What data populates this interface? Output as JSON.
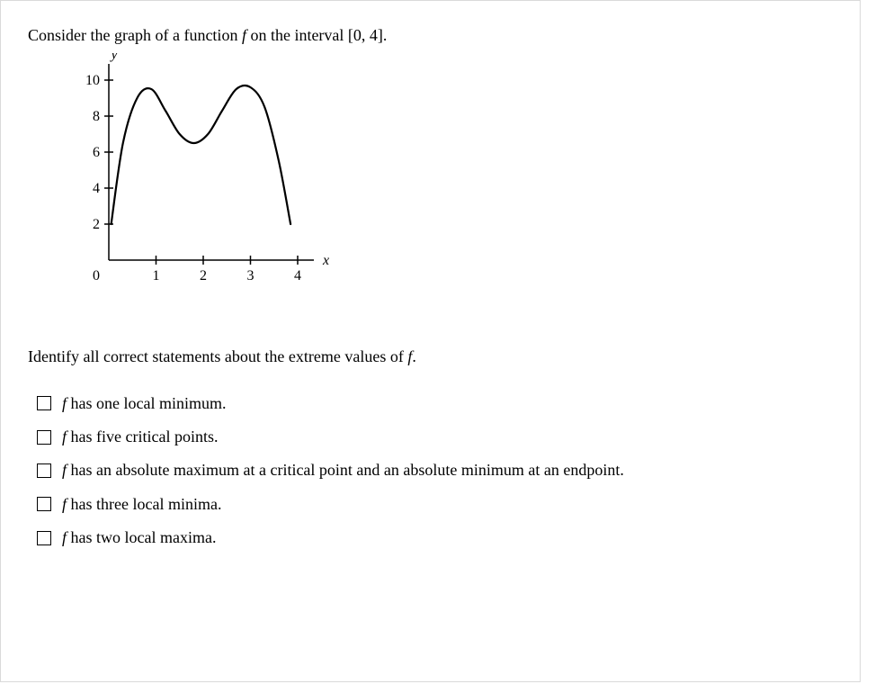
{
  "intro": {
    "prefix": "Consider the graph of a function ",
    "func": "f",
    "middle": " on the interval ",
    "interval": "[0, 4]",
    "suffix": "."
  },
  "chart_data": {
    "type": "line",
    "title": "",
    "xlabel": "x",
    "ylabel": "y",
    "xlim": [
      0,
      4
    ],
    "ylim": [
      0,
      10
    ],
    "x_ticks": [
      0,
      1,
      2,
      3,
      4
    ],
    "y_ticks": [
      2,
      4,
      6,
      8,
      10
    ],
    "series": [
      {
        "name": "f",
        "x": [
          0.05,
          0.3,
          0.6,
          0.9,
          1.2,
          1.5,
          1.8,
          2.1,
          2.4,
          2.7,
          3.0,
          3.3,
          3.6,
          3.85
        ],
        "y": [
          2.0,
          6.5,
          9.0,
          9.5,
          8.3,
          7.0,
          6.5,
          7.0,
          8.3,
          9.5,
          9.6,
          8.5,
          5.5,
          2.0
        ]
      }
    ]
  },
  "prompt2": {
    "prefix": "Identify all correct statements about the extreme values of ",
    "func": "f",
    "suffix": "."
  },
  "options": [
    {
      "func": "f",
      "text": " has one local minimum."
    },
    {
      "func": "f",
      "text": " has five critical points."
    },
    {
      "func": "f",
      "text": " has an absolute maximum at a critical point and an absolute minimum at an endpoint."
    },
    {
      "func": "f",
      "text": " has three local minima."
    },
    {
      "func": "f",
      "text": " has two local maxima."
    }
  ]
}
